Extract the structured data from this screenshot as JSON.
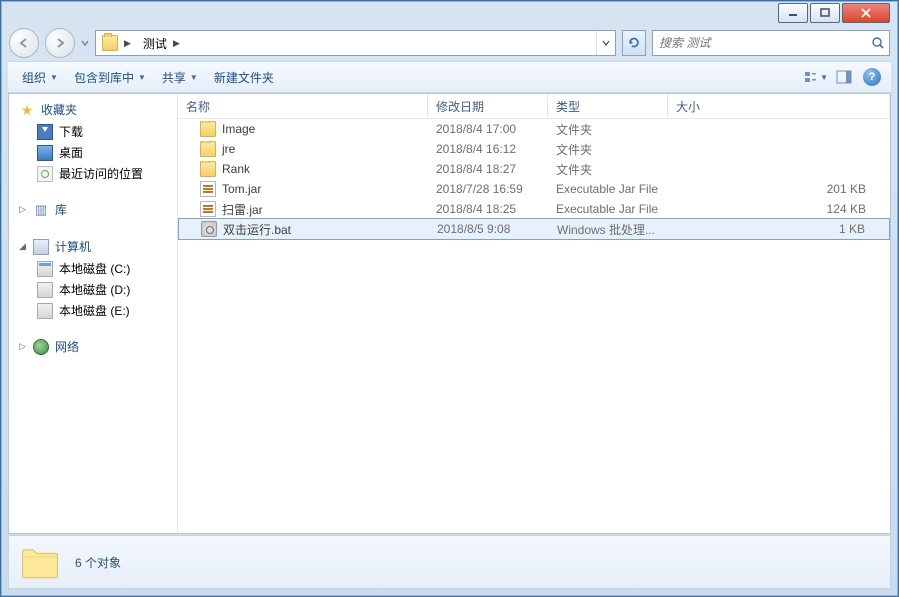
{
  "titlebar": {},
  "nav": {
    "folder_icon_name": "folder-icon",
    "path_current": "测试",
    "search_placeholder": "搜索 测试"
  },
  "toolbar": {
    "organize": "组织",
    "include": "包含到库中",
    "share": "共享",
    "new_folder": "新建文件夹"
  },
  "sidebar": {
    "favorites": {
      "label": "收藏夹"
    },
    "favorites_items": [
      {
        "label": "下载",
        "icon": "download-icon"
      },
      {
        "label": "桌面",
        "icon": "desktop-icon"
      },
      {
        "label": "最近访问的位置",
        "icon": "recent-icon"
      }
    ],
    "libraries": {
      "label": "库"
    },
    "computer": {
      "label": "计算机"
    },
    "drives": [
      {
        "label": "本地磁盘 (C:)",
        "icon": "drive-c-icon"
      },
      {
        "label": "本地磁盘 (D:)",
        "icon": "drive-icon"
      },
      {
        "label": "本地磁盘 (E:)",
        "icon": "drive-icon"
      }
    ],
    "network": {
      "label": "网络"
    }
  },
  "columns": {
    "name": "名称",
    "date": "修改日期",
    "type": "类型",
    "size": "大小"
  },
  "files": [
    {
      "name": "Image",
      "date": "2018/8/4 17:00",
      "type": "文件夹",
      "size": "",
      "icon": "folder",
      "selected": false
    },
    {
      "name": "jre",
      "date": "2018/8/4 16:12",
      "type": "文件夹",
      "size": "",
      "icon": "folder",
      "selected": false
    },
    {
      "name": "Rank",
      "date": "2018/8/4 18:27",
      "type": "文件夹",
      "size": "",
      "icon": "folder",
      "selected": false
    },
    {
      "name": "Tom.jar",
      "date": "2018/7/28 16:59",
      "type": "Executable Jar File",
      "size": "201 KB",
      "icon": "jar",
      "selected": false
    },
    {
      "name": "扫雷.jar",
      "date": "2018/8/4 18:25",
      "type": "Executable Jar File",
      "size": "124 KB",
      "icon": "jar",
      "selected": false
    },
    {
      "name": "双击运行.bat",
      "date": "2018/8/5 9:08",
      "type": "Windows 批处理...",
      "size": "1 KB",
      "icon": "bat",
      "selected": true
    }
  ],
  "details": {
    "summary": "6 个对象"
  }
}
